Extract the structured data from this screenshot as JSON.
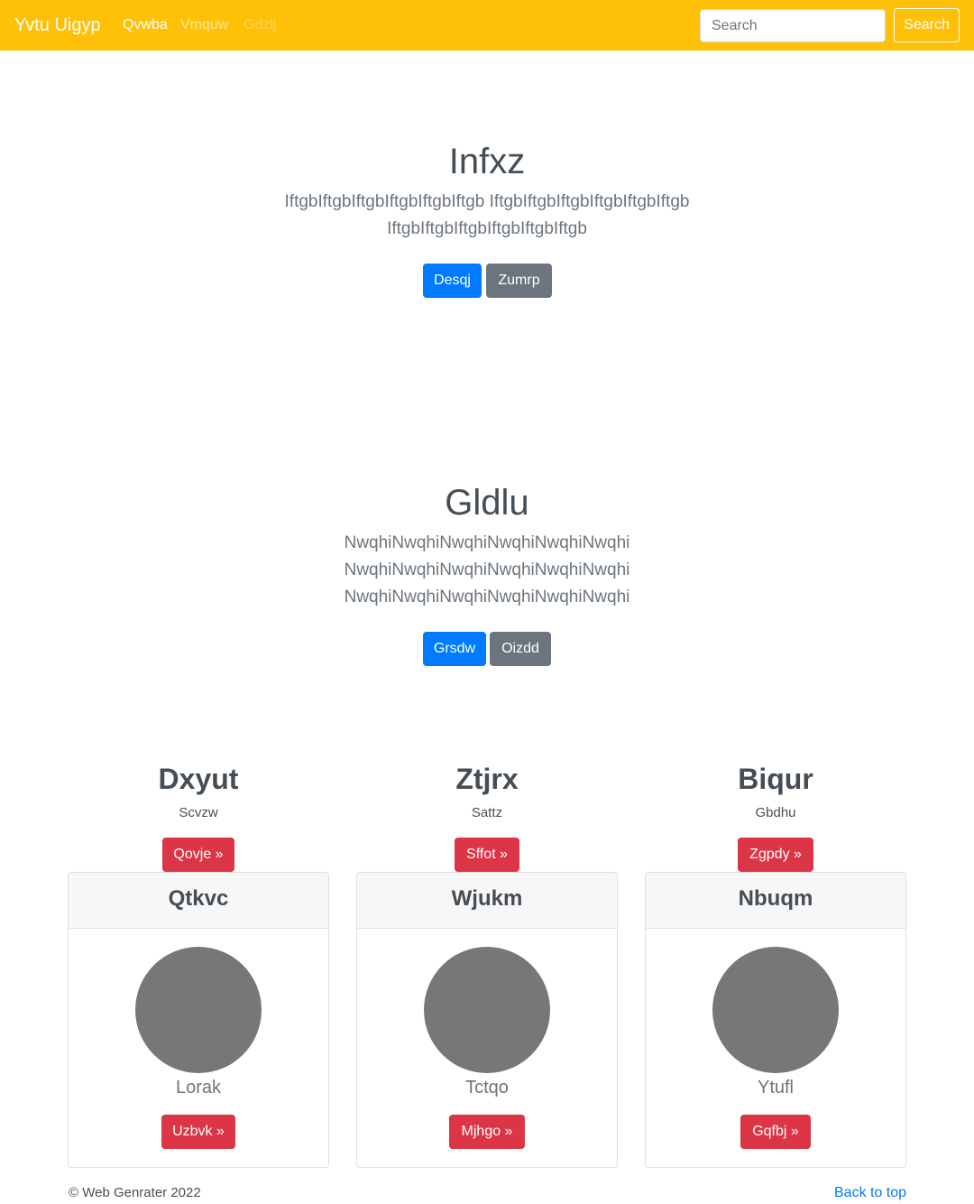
{
  "navbar": {
    "brand": "Yvtu Uigyp",
    "links": [
      "Qvwba",
      "Vmquw",
      "Gdzlj"
    ],
    "search_placeholder": "Search",
    "search_button": "Search",
    "color": "#ffc107"
  },
  "hero1": {
    "title": "Infxz",
    "lines": [
      "IftgbIftgbIftgbIftgbIftgbIftgb IftgbIftgbIftgbIftgbIftgbIftgb",
      "IftgbIftgbIftgbIftgbIftgbIftgb"
    ],
    "primary_button": "Desqj",
    "secondary_button": "Zumrp"
  },
  "hero2": {
    "title": "Gldlu",
    "lines": [
      "NwqhiNwqhiNwqhiNwqhiNwqhiNwqhi",
      "NwqhiNwqhiNwqhiNwqhiNwqhiNwqhi",
      "NwqhiNwqhiNwqhiNwqhiNwqhiNwqhi"
    ],
    "primary_button": "Grsdw",
    "secondary_button": "Oizdd"
  },
  "columns": [
    {
      "title": "Dxyut",
      "subtitle": "Scvzw",
      "button": "Qovje »"
    },
    {
      "title": "Ztjrx",
      "subtitle": "Sattz",
      "button": "Sffot »"
    },
    {
      "title": "Biqur",
      "subtitle": "Gbdhu",
      "button": "Zgpdy »"
    }
  ],
  "cards": [
    {
      "header": "Qtkvc",
      "name": "Lorak",
      "button": "Uzbvk »"
    },
    {
      "header": "Wjukm",
      "name": "Tctqo",
      "button": "Mjhgo »"
    },
    {
      "header": "Nbuqm",
      "name": "Ytufl",
      "button": "Gqfbj »"
    }
  ],
  "footer": {
    "copyright": "© Web Genrater 2022",
    "back_to_top": "Back to top"
  },
  "colors": {
    "primary": "#007bff",
    "secondary": "#6c757d",
    "danger": "#dc3545",
    "avatar": "#777777"
  }
}
